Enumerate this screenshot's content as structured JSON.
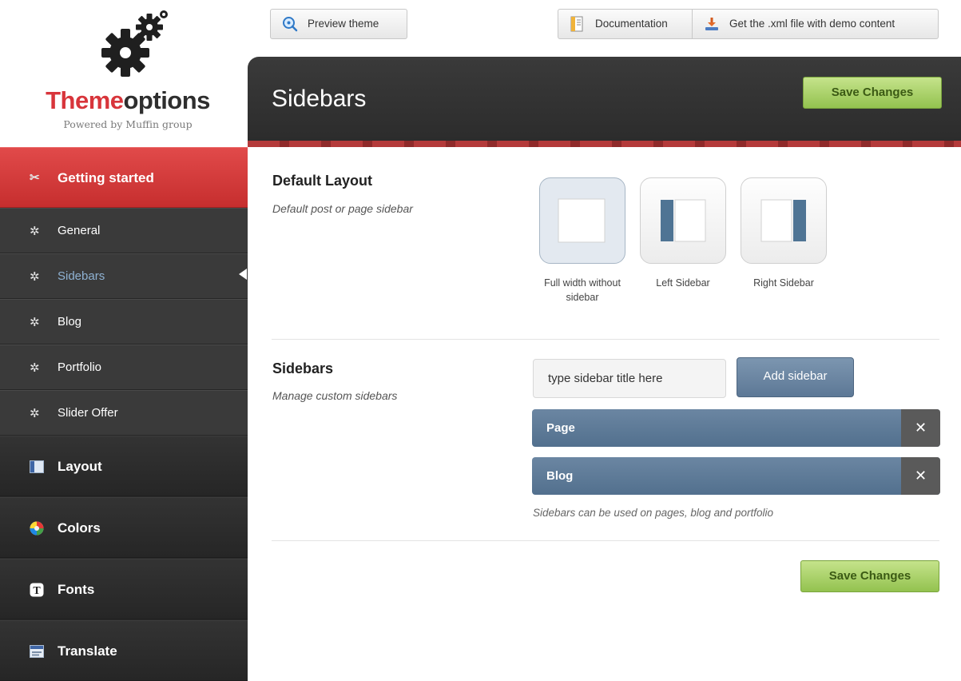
{
  "brand": {
    "title_part1": "Theme",
    "title_part2": "options",
    "subtitle": "Powered by Muffin group"
  },
  "nav": {
    "getting_started": "Getting started",
    "sub_items": [
      "General",
      "Sidebars",
      "Blog",
      "Portfolio",
      "Slider Offer"
    ],
    "selected": "Sidebars",
    "layout": "Layout",
    "colors": "Colors",
    "fonts": "Fonts",
    "translate": "Translate"
  },
  "toolbar": {
    "preview": "Preview theme",
    "documentation": "Documentation",
    "get_xml": "Get the .xml file with demo content"
  },
  "page": {
    "title": "Sidebars",
    "save_label": "Save Changes"
  },
  "default_layout": {
    "title": "Default Layout",
    "description": "Default post or page sidebar",
    "options": [
      "Full width without sidebar",
      "Left Sidebar",
      "Right Sidebar"
    ],
    "selected": "Full width without sidebar"
  },
  "sidebars": {
    "title": "Sidebars",
    "description": "Manage custom sidebars",
    "input_value": "type sidebar title here",
    "add_label": "Add sidebar",
    "items": [
      "Page",
      "Blog"
    ],
    "delete_glyph": "✕",
    "help": "Sidebars can be used on pages, blog and portfolio"
  },
  "colors": {
    "accent_red": "#d8353b",
    "sidebar_bg": "#2b2b2b",
    "save_green": "#93c24f",
    "sidebar_item_blue": "#52708e"
  }
}
